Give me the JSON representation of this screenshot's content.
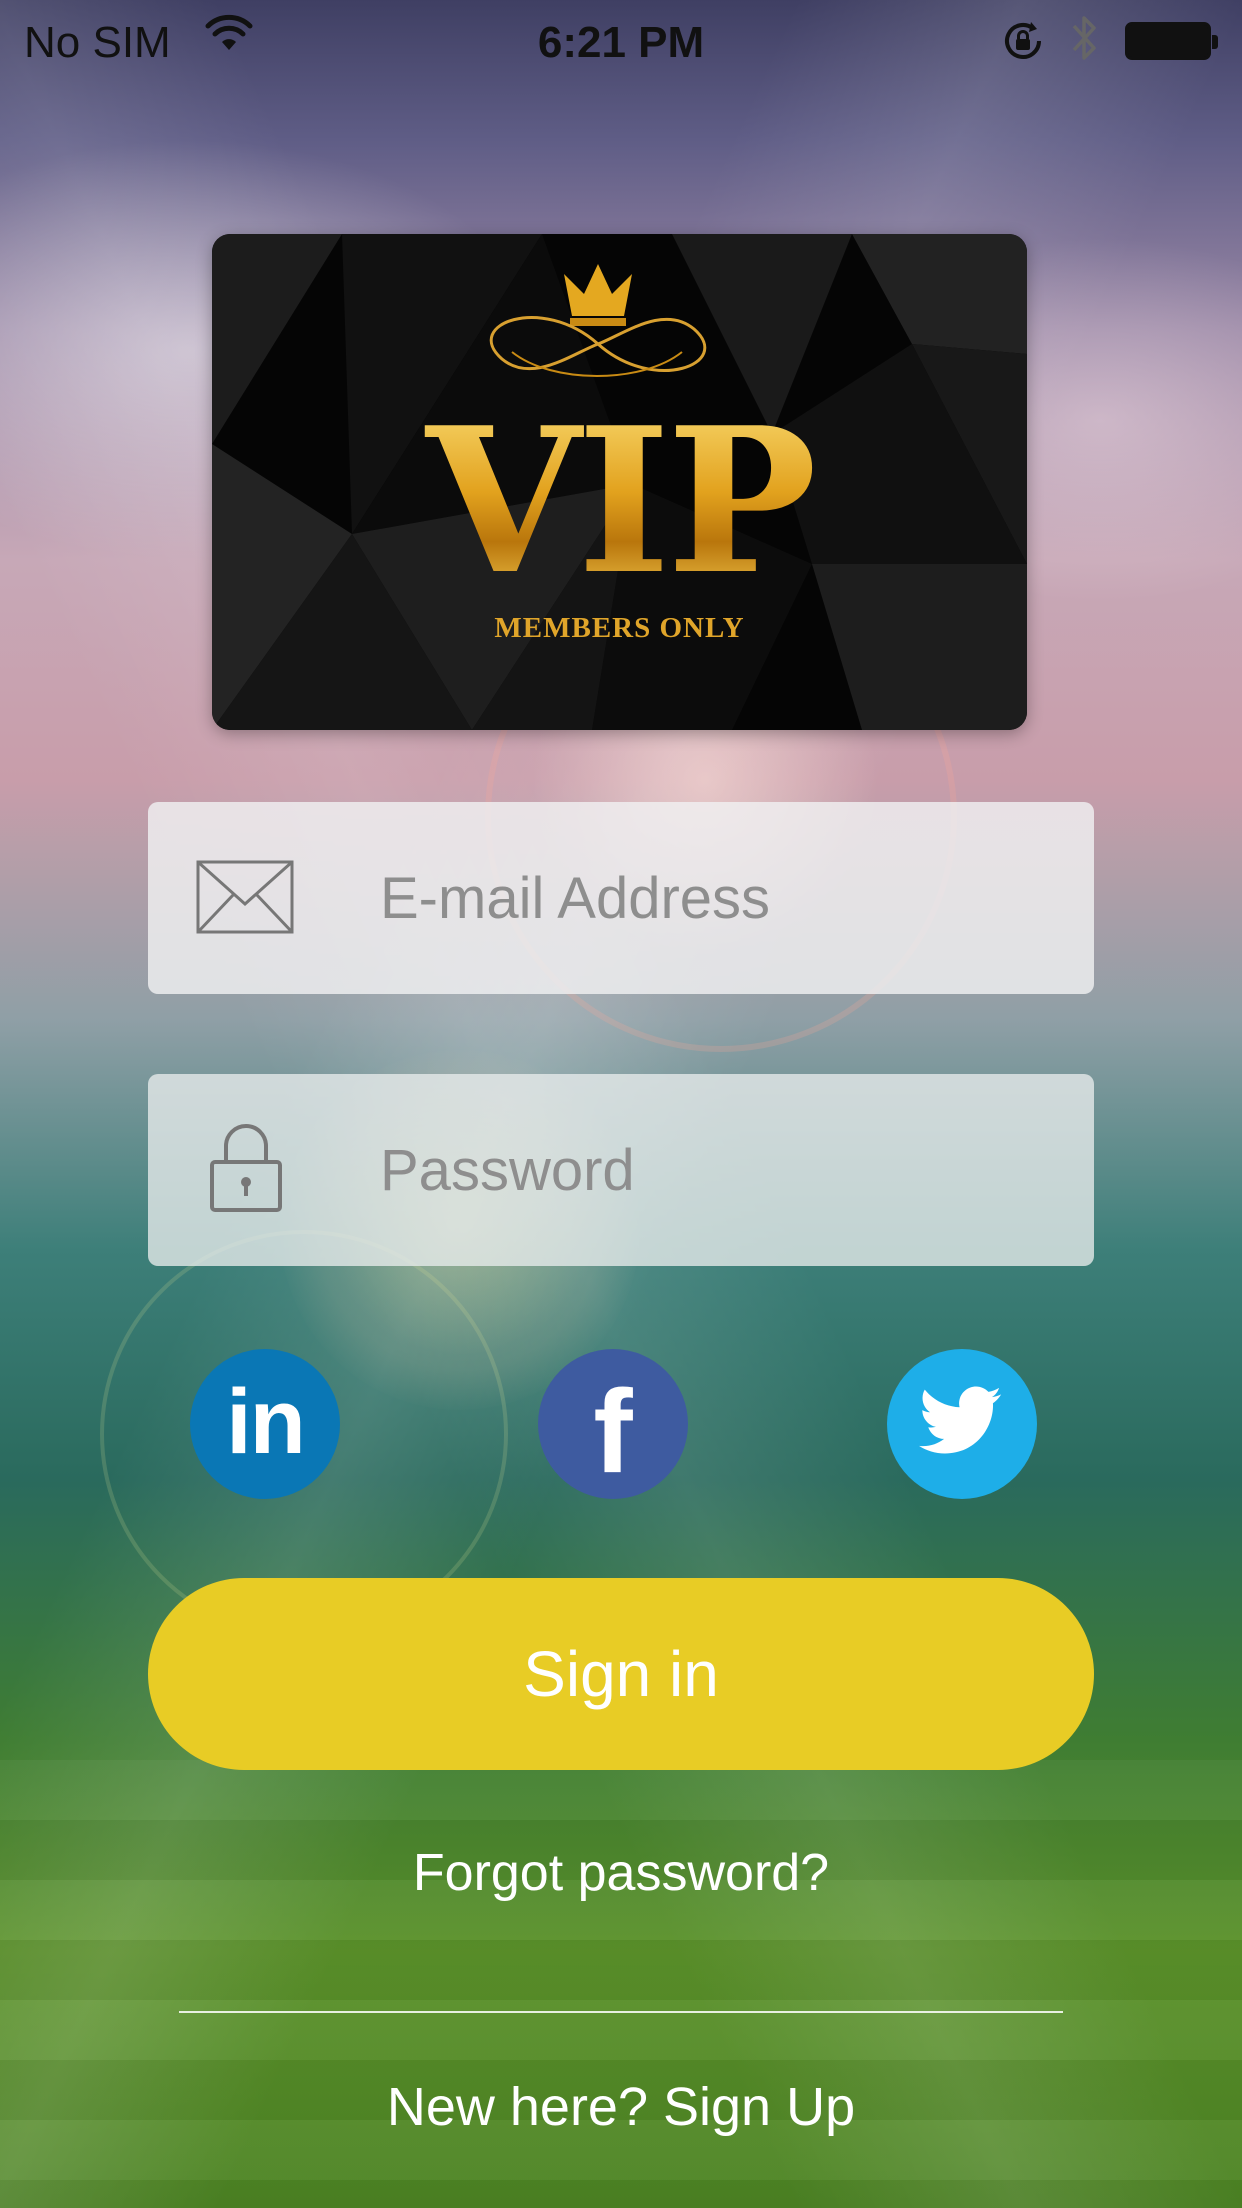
{
  "status_bar": {
    "carrier": "No SIM",
    "time": "6:21 PM"
  },
  "logo": {
    "title": "VIP",
    "subtitle": "MEMBERS ONLY",
    "accent_color": "#e7ac25"
  },
  "form": {
    "email": {
      "placeholder": "E-mail Address",
      "value": "",
      "icon": "envelope-icon"
    },
    "password": {
      "placeholder": "Password",
      "value": "",
      "icon": "lock-icon"
    }
  },
  "social": {
    "linkedin": {
      "glyph": "in",
      "color": "#0a77b5"
    },
    "facebook": {
      "glyph": "f",
      "color": "#3e5ba0"
    },
    "twitter": {
      "color": "#1eaee8"
    }
  },
  "actions": {
    "sign_in_label": "Sign in",
    "sign_in_color": "#e8cc25",
    "forgot_password": "Forgot password?",
    "sign_up": "New here? Sign Up"
  }
}
